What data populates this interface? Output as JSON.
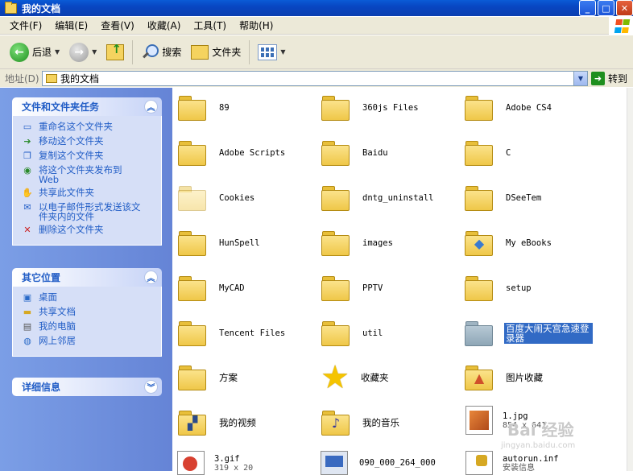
{
  "window": {
    "title": "我的文档",
    "min": "_",
    "max": "□",
    "close": "✕"
  },
  "menu": [
    "文件(F)",
    "编辑(E)",
    "查看(V)",
    "收藏(A)",
    "工具(T)",
    "帮助(H)"
  ],
  "toolbar": {
    "back": "后退",
    "search": "搜索",
    "folders": "文件夹"
  },
  "address": {
    "label": "地址(D)",
    "value": "我的文档",
    "go": "转到"
  },
  "tasks_panel": {
    "title": "文件和文件夹任务",
    "items": [
      "重命名这个文件夹",
      "移动这个文件夹",
      "复制这个文件夹",
      "将这个文件夹发布到 Web",
      "共享此文件夹",
      "以电子邮件形式发送该文件夹内的文件",
      "删除这个文件夹"
    ]
  },
  "places_panel": {
    "title": "其它位置",
    "items": [
      "桌面",
      "共享文档",
      "我的电脑",
      "网上邻居"
    ]
  },
  "details_panel": {
    "title": "详细信息"
  },
  "folders": [
    {
      "name": "89"
    },
    {
      "name": "360js Files"
    },
    {
      "name": "Adobe CS4"
    },
    {
      "name": "Adobe Scripts"
    },
    {
      "name": "Baidu"
    },
    {
      "name": "C"
    },
    {
      "name": "Cookies"
    },
    {
      "name": "dntg_uninstall"
    },
    {
      "name": "DSeeTem"
    },
    {
      "name": "HunSpell"
    },
    {
      "name": "images"
    },
    {
      "name": "My eBooks"
    },
    {
      "name": "MyCAD"
    },
    {
      "name": "PPTV"
    },
    {
      "name": "setup"
    },
    {
      "name": "Tencent Files"
    },
    {
      "name": "util"
    },
    {
      "name": "百度大闹天宫急速登录器"
    },
    {
      "name": "方案"
    },
    {
      "name": "收藏夹"
    },
    {
      "name": "图片收藏"
    },
    {
      "name": "我的视频"
    },
    {
      "name": "我的音乐"
    },
    {
      "name": "1.jpg",
      "sub": "854 x 641"
    },
    {
      "name": "3.gif",
      "sub": "319 x 20"
    },
    {
      "name": "090_000_264_000"
    },
    {
      "name": "autorun.inf",
      "sub": "安装信息"
    }
  ],
  "watermark": {
    "brand": "Bai 经验",
    "url": "jingyan.baidu.com"
  }
}
